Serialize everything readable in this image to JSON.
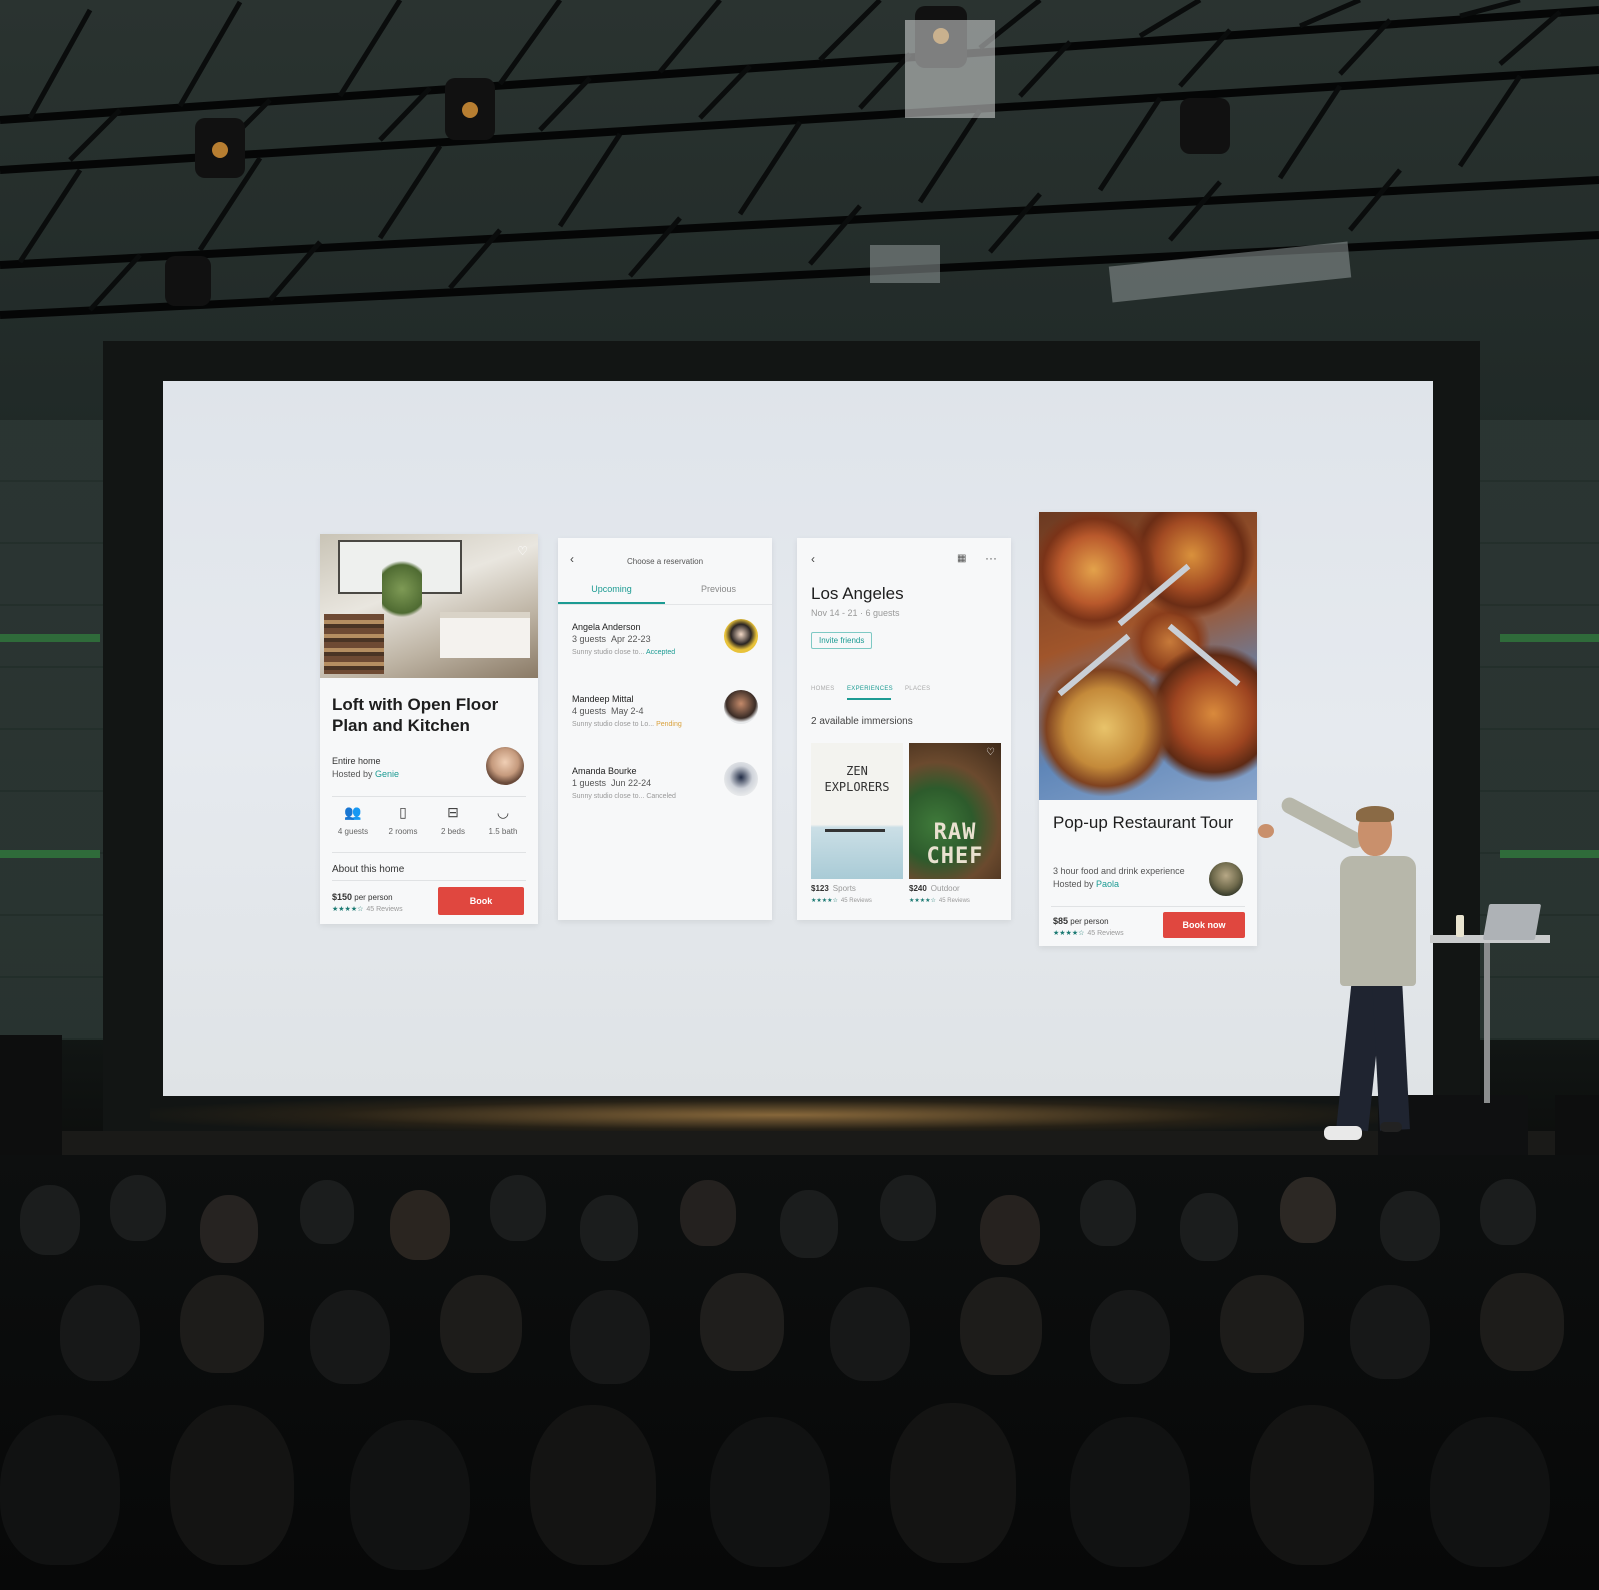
{
  "colors": {
    "accent_teal": "#1c9b93",
    "book_red": "#e0473f",
    "screen_bg": "#e3e7ec",
    "venue_dark": "#0b0d0d"
  },
  "card_listing": {
    "title": "Loft with Open Floor Plan and Kitchen",
    "type": "Entire home",
    "hosted_by_label": "Hosted by",
    "host_name": "Genie",
    "amenities": [
      {
        "icon": "guests-icon",
        "label": "4 guests"
      },
      {
        "icon": "door-icon",
        "label": "2 rooms"
      },
      {
        "icon": "bed-icon",
        "label": "2 beds"
      },
      {
        "icon": "bath-icon",
        "label": "1.5 bath"
      }
    ],
    "about_label": "About this home",
    "price": "$150",
    "price_unit": "per person",
    "stars": "★★★★☆",
    "reviews": "45 Reviews",
    "book_label": "Book"
  },
  "card_reservations": {
    "header": "Choose a reservation",
    "tabs": [
      "Upcoming",
      "Previous"
    ],
    "items": [
      {
        "name": "Angela Anderson",
        "guests": "3 guests",
        "dates": "Apr 22-23",
        "desc": "Sunny studio close to...",
        "status": "Accepted"
      },
      {
        "name": "Mandeep Mittal",
        "guests": "4 guests",
        "dates": "May 2-4",
        "desc": "Sunny studio close to Lo...",
        "status": "Pending"
      },
      {
        "name": "Amanda Bourke",
        "guests": "1 guests",
        "dates": "Jun 22-24",
        "desc": "Sunny studio close to...",
        "status": "Canceled"
      }
    ]
  },
  "card_trip": {
    "city": "Los Angeles",
    "dates": "Nov 14 - 21 · 6 guests",
    "invite_label": "Invite friends",
    "tabs": [
      "HOMES",
      "EXPERIENCES",
      "PLACES"
    ],
    "available": "2 available immersions",
    "experiences": [
      {
        "title": "ZEN EXPLORERS",
        "price": "$123",
        "category": "Sports",
        "stars": "★★★★☆",
        "reviews": "45 Reviews"
      },
      {
        "title": "RAW CHEF",
        "price": "$240",
        "category": "Outdoor",
        "stars": "★★★★☆",
        "reviews": "45 Reviews"
      }
    ]
  },
  "card_experience": {
    "title": "Pop-up Restaurant Tour",
    "desc": "3 hour food and drink experience",
    "hosted_by_label": "Hosted by",
    "host_name": "Paola",
    "price": "$85",
    "price_unit": "per person",
    "stars": "★★★★☆",
    "reviews": "45 Reviews",
    "book_label": "Book now"
  }
}
